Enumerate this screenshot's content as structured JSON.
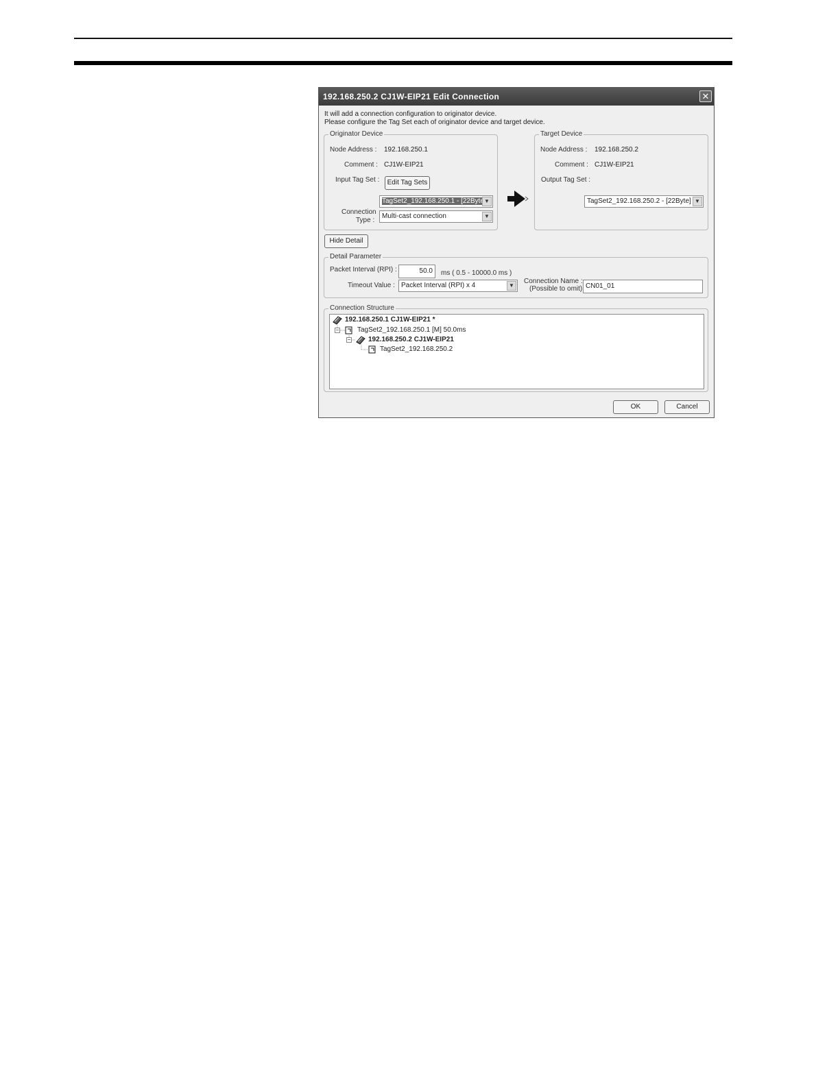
{
  "dialog": {
    "title": "192.168.250.2 CJ1W-EIP21 Edit Connection",
    "close_glyph": "✕",
    "intro_line1": "It will add a connection configuration to originator device.",
    "intro_line2": "Please configure the Tag Set each of originator device and target device."
  },
  "originator": {
    "legend": "Originator Device",
    "node_address_label": "Node Address :",
    "node_address": "192.168.250.1",
    "comment_label": "Comment :",
    "comment": "CJ1W-EIP21",
    "input_tag_set_label": "Input Tag Set :",
    "edit_tag_sets_label": "Edit Tag Sets",
    "input_tag_set_value": "TagSet2_192.168.250.1 - [22Byte]",
    "connection_type_label1": "Connection",
    "connection_type_label2": "Type :",
    "connection_type_value": "Multi-cast connection"
  },
  "target": {
    "legend": "Target Device",
    "node_address_label": "Node Address :",
    "node_address": "192.168.250.2",
    "comment_label": "Comment :",
    "comment": "CJ1W-EIP21",
    "output_tag_set_label": "Output Tag Set :",
    "output_tag_set_value": "TagSet2_192.168.250.2 - [22Byte]"
  },
  "hide_detail_label": "Hide Detail",
  "detail": {
    "legend": "Detail Parameter",
    "packet_interval_label": "Packet Interval (RPI) :",
    "packet_interval_value": "50.0",
    "packet_interval_range": "ms ( 0.5 - 10000.0 ms )",
    "timeout_label": "Timeout Value :",
    "timeout_value": "Packet Interval (RPI) x 4",
    "connection_name_label1": "Connection Name :",
    "connection_name_label2": "(Possible to omit)",
    "connection_name_value": "CN01_01"
  },
  "structure": {
    "legend": "Connection Structure",
    "node1": "192.168.250.1 CJ1W-EIP21 *",
    "tagset1": "TagSet2_192.168.250.1 [M] 50.0ms",
    "node2": "192.168.250.2 CJ1W-EIP21",
    "tagset2": "TagSet2_192.168.250.2",
    "expander_glyph": "−"
  },
  "footer": {
    "ok_label": "OK",
    "cancel_label": "Cancel"
  },
  "icons": {
    "connection_arrow": "connection-arrow-icon",
    "device": "device-icon",
    "tagset": "tagset-icon"
  }
}
